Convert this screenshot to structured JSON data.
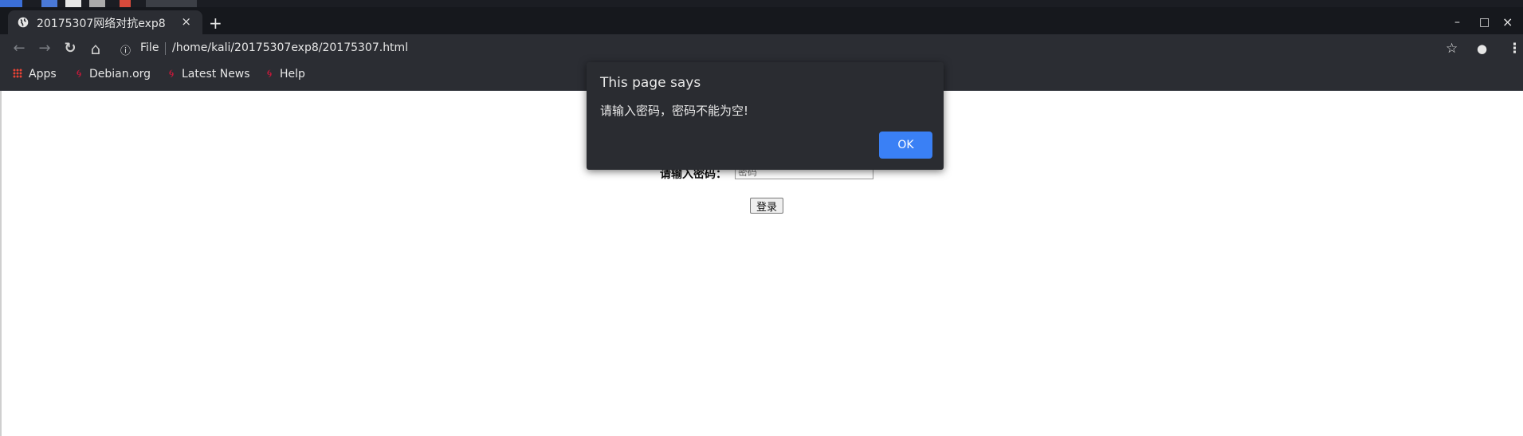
{
  "browser": {
    "tab": {
      "title": "20175307网络对抗exp8",
      "close": "×"
    },
    "new_tab": "+",
    "window_controls": {
      "minimize": "–",
      "maximize": "□",
      "close": "×"
    }
  },
  "toolbar": {
    "back": "←",
    "forward": "→",
    "reload": "↻",
    "home": "⌂",
    "info": "ⓘ",
    "scheme_label": "File",
    "url": "/home/kali/20175307exp8/20175307.html",
    "bookmark_star": "☆",
    "profile": "●",
    "menu": "⋮"
  },
  "bookmarks": [
    {
      "label": "Apps",
      "icon": "apps-grid-icon"
    },
    {
      "label": "Debian.org",
      "icon": "debian-swirl-icon"
    },
    {
      "label": "Latest News",
      "icon": "debian-swirl-icon"
    },
    {
      "label": "Help",
      "icon": "debian-swirl-icon"
    }
  ],
  "page": {
    "password_label": "请输入密码：",
    "password_placeholder": "密码",
    "login_button": "登录"
  },
  "dialog": {
    "title": "This page says",
    "message": "请输入密码，密码不能为空!",
    "ok_button": "OK"
  },
  "colors": {
    "chrome_dark": "#2b2d33",
    "tabstrip": "#16181d",
    "accent_blue": "#3a80f5",
    "debian_red": "#c0193a"
  }
}
